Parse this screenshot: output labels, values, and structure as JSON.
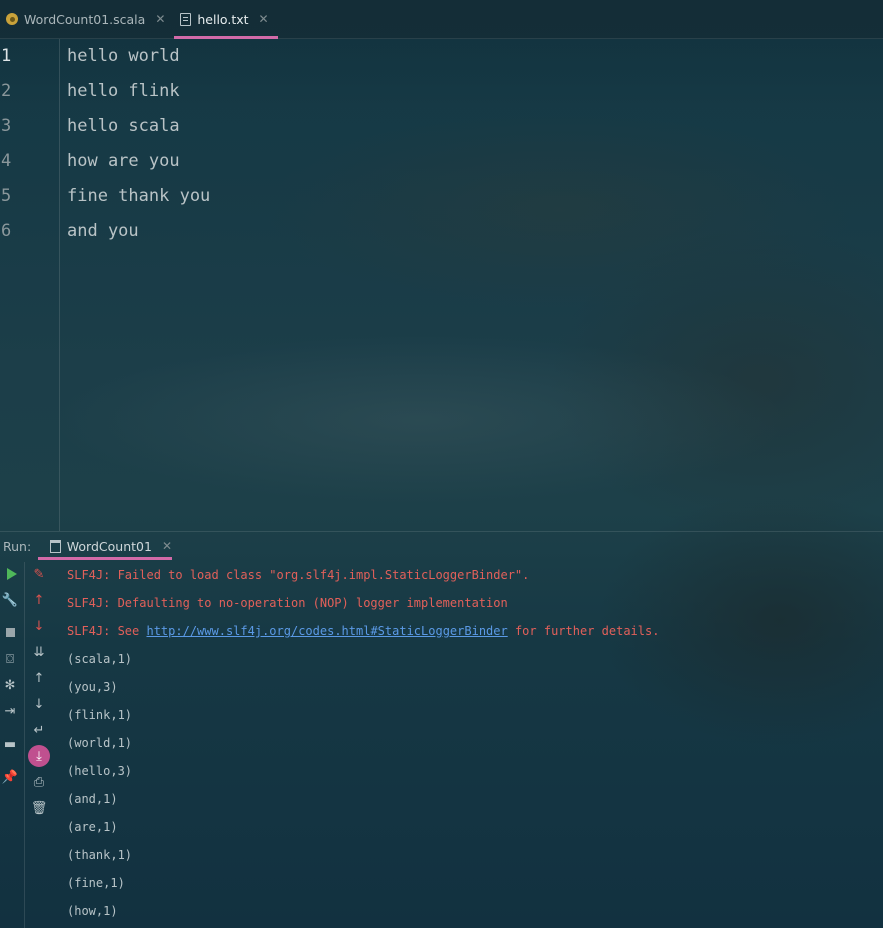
{
  "tabs": [
    {
      "label": "WordCount01.scala",
      "icon": "scala-file-icon",
      "active": false
    },
    {
      "label": "hello.txt",
      "icon": "text-file-icon",
      "active": true
    }
  ],
  "editor": {
    "lines": [
      {
        "num": "1",
        "text": "hello world"
      },
      {
        "num": "2",
        "text": "hello flink"
      },
      {
        "num": "3",
        "text": "hello scala"
      },
      {
        "num": "4",
        "text": "how are you"
      },
      {
        "num": "5",
        "text": "fine thank you"
      },
      {
        "num": "6",
        "text": "and you"
      }
    ]
  },
  "run": {
    "label": "Run:",
    "tab_label": "WordCount01"
  },
  "console": {
    "err1": "SLF4J: Failed to load class \"org.slf4j.impl.StaticLoggerBinder\".",
    "err2": "SLF4J: Defaulting to no-operation (NOP) logger implementation",
    "err3_prefix": "SLF4J: See ",
    "err3_link": "http://www.slf4j.org/codes.html#StaticLoggerBinder",
    "err3_suffix": " for further details.",
    "output": [
      "(scala,1)",
      "(you,3)",
      "(flink,1)",
      "(world,1)",
      "(hello,3)",
      "(and,1)",
      "(are,1)",
      "(thank,1)",
      "(fine,1)",
      "(how,1)"
    ]
  },
  "colors": {
    "accent": "#d26aa8",
    "error_text": "#e2605a",
    "link": "#5b9ae6",
    "run_green": "#4fb85a"
  }
}
